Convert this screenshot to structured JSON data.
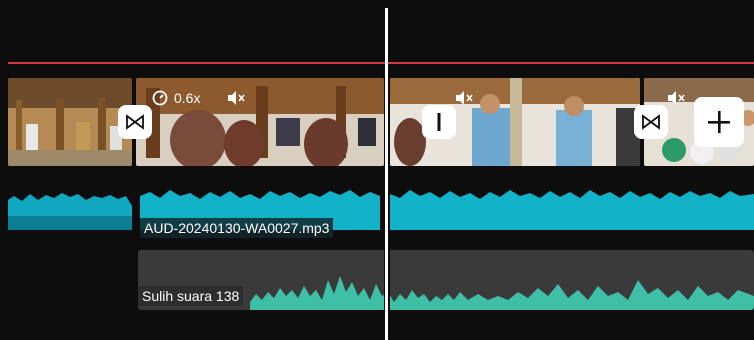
{
  "timeline": {
    "video_clip": {
      "speed_label": "0.6x",
      "speed_icon": "speed-gauge-icon",
      "mute_icon": "speaker-muted-icon"
    },
    "buttons": {
      "transition_icon": "bowtie-transition-icon",
      "split_icon": "split-bar-icon",
      "add_icon": "plus-icon"
    },
    "audio_track": {
      "label": "AUD-20240130-WA0027.mp3",
      "color": "#12b3c9"
    },
    "voice_track": {
      "label": "Sulih suara 138",
      "color": "#3fbfa6"
    },
    "colors": {
      "redline": "#d23b3b",
      "playhead": "#ffffff",
      "background": "#0d0d0d"
    }
  }
}
